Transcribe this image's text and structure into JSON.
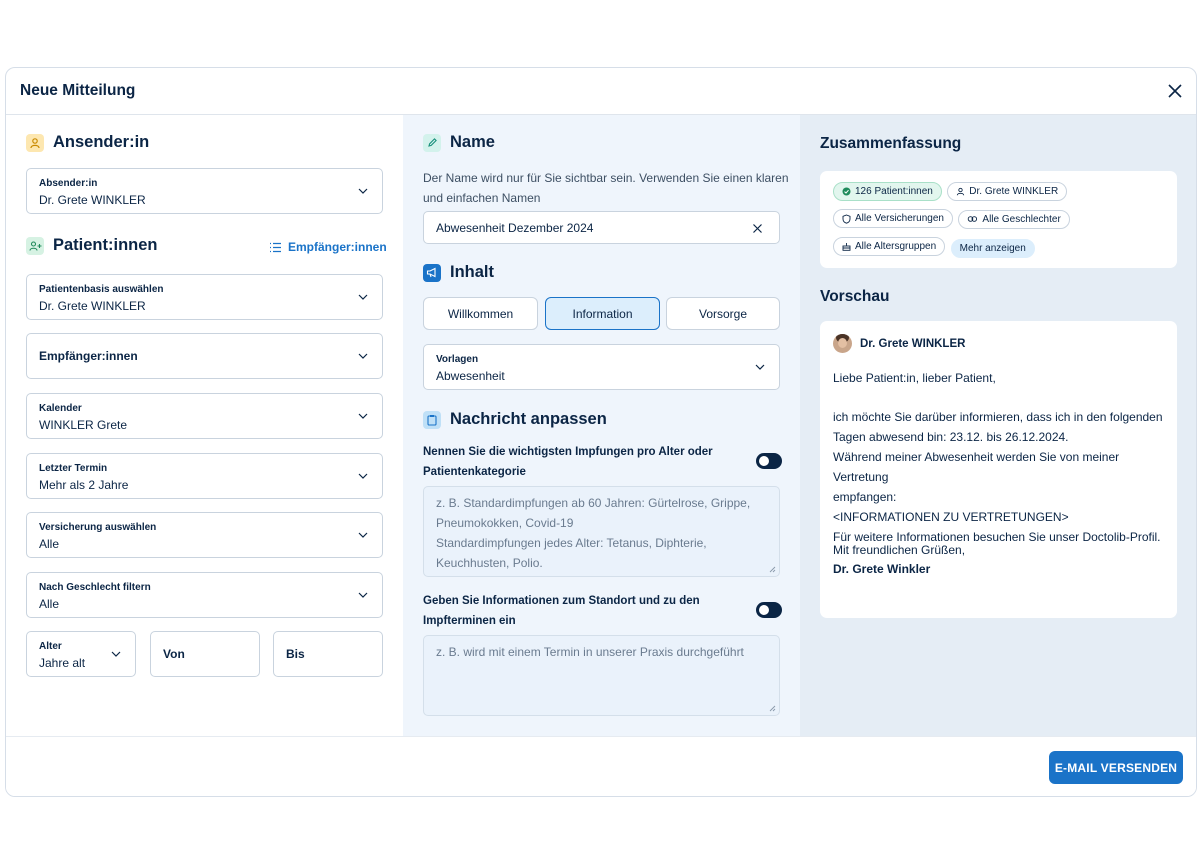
{
  "modal": {
    "title": "Neue Mitteilung"
  },
  "sender": {
    "title": "Ansender:in",
    "field_label": "Absender:in",
    "field_value": "Dr. Grete WINKLER"
  },
  "patients": {
    "title": "Patient:innen",
    "recipients_link": "Empfänger:innen",
    "base": {
      "label": "Patientenbasis auswählen",
      "value": "Dr. Grete WINKLER"
    },
    "recipients": {
      "label": "Empfänger:innen"
    },
    "calendar": {
      "label": "Kalender",
      "value": "WINKLER Grete"
    },
    "last_appointment": {
      "label": "Letzter Termin",
      "value": "Mehr als 2 Jahre"
    },
    "insurance": {
      "label": "Versicherung auswählen",
      "value": "Alle"
    },
    "gender": {
      "label": "Nach Geschlecht filtern",
      "value": "Alle"
    },
    "age": {
      "label": "Alter",
      "value": "Jahre alt"
    },
    "from": {
      "label": "Von"
    },
    "to": {
      "label": "Bis"
    }
  },
  "name_section": {
    "title": "Name",
    "helper_line1": "Der Name wird nur für Sie sichtbar sein. Verwenden Sie einen klaren",
    "helper_line2": "und einfachen Namen",
    "value": "Abwesenheit Dezember 2024"
  },
  "content_section": {
    "title": "Inhalt",
    "options": [
      "Willkommen",
      "Information",
      "Vorsorge"
    ],
    "active_option": "Information",
    "templates": {
      "label": "Vorlagen",
      "value": "Abwesenheit"
    }
  },
  "customize_section": {
    "title": "Nachricht anpassen",
    "q1_line1": "Nennen Sie die wichtigsten Impfungen pro Alter oder",
    "q1_line2": "Patientenkategorie",
    "q1_placeholder": [
      "z. B. Standardimpfungen ab 60 Jahren: Gürtelrose, Grippe,",
      "Pneumokokken, Covid-19",
      "Standardimpfungen jedes Alter: Tetanus, Diphterie,",
      "Keuchhusten, Polio."
    ],
    "q2_line1": "Geben Sie Informationen zum Standort und zu den",
    "q2_line2": "Impfterminen ein",
    "q2_placeholder": "z. B. wird mit einem Termin in unserer Praxis durchgeführt"
  },
  "summary": {
    "title": "Zusammenfassung",
    "chips": {
      "patients": "126 Patient:innen",
      "doctor": "Dr. Grete WINKLER",
      "insurances": "Alle Versicherungen",
      "genders": "Alle Geschlechter",
      "ages": "Alle Altersgruppen",
      "more": "Mehr anzeigen"
    }
  },
  "preview": {
    "title": "Vorschau",
    "sender_name": "Dr. Grete WINKLER",
    "greeting": "Liebe Patient:in, lieber Patient,",
    "body": [
      "ich möchte Sie darüber informieren, dass ich in den folgenden",
      "Tagen abwesend bin: 23.12. bis 26.12.2024.",
      "Während meiner Abwesenheit werden Sie von meiner Vertretung",
      "empfangen:",
      "<INFORMATIONEN ZU VERTRETUNGEN>",
      "Für weitere Informationen besuchen Sie unser Doctolib-Profil."
    ],
    "closing": "Mit freundlichen Grüßen,",
    "signature": "Dr. Grete Winkler"
  },
  "footer": {
    "send_label": "E-MAIL VERSENDEN"
  },
  "colors": {
    "primary": "#1a73c8",
    "navy": "#0b2545",
    "mid_bg": "#eff5fc",
    "right_bg": "#e5edf5"
  }
}
